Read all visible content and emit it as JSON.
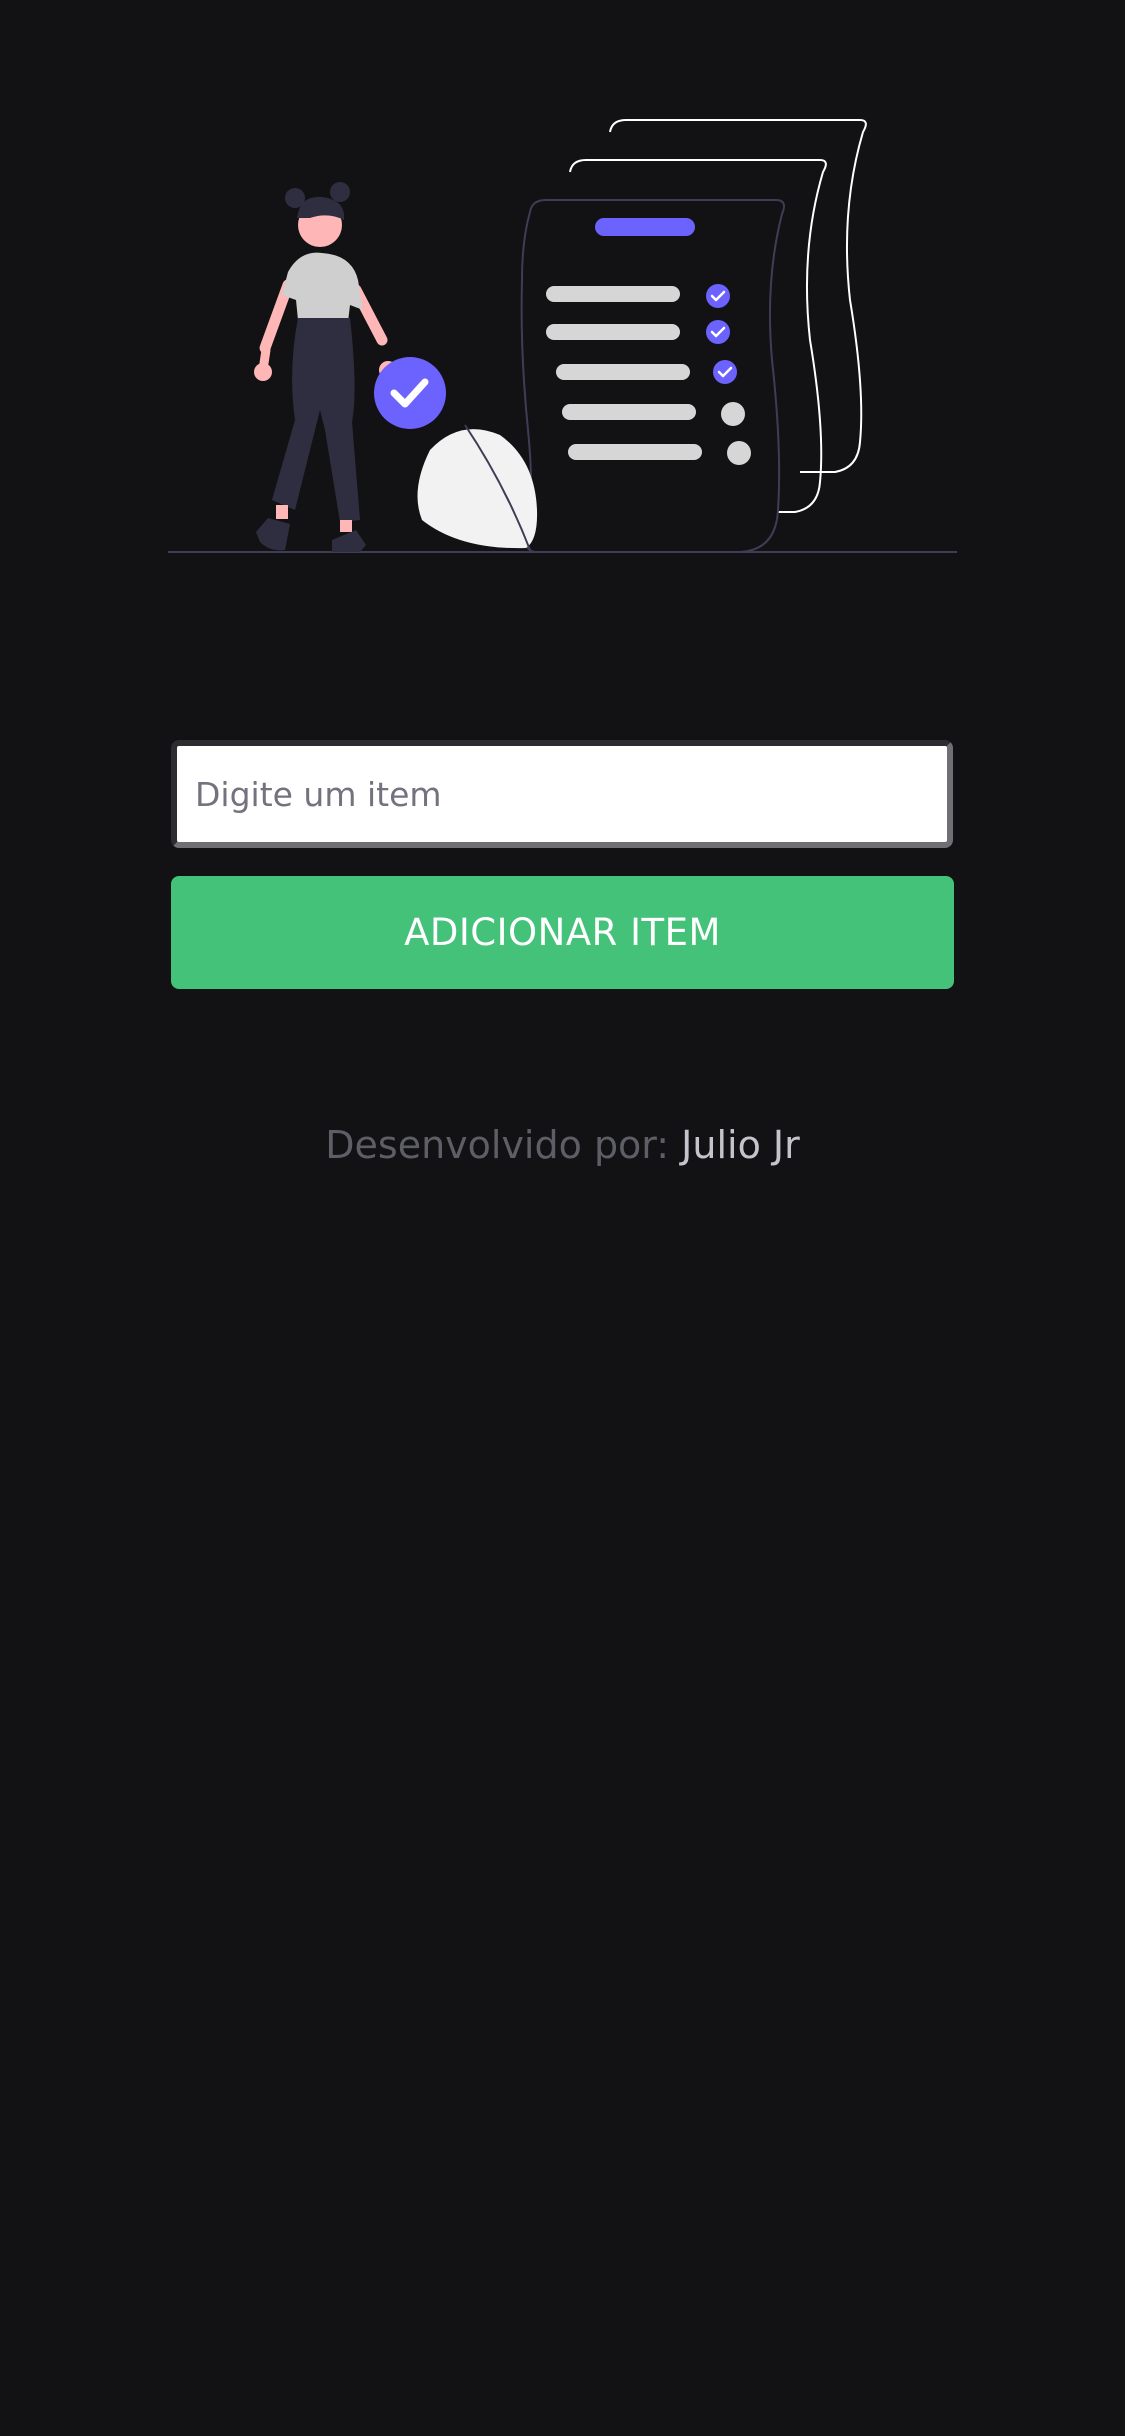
{
  "illustration": {
    "name": "todo-list-illustration",
    "colors": {
      "accent": "#6c63ff",
      "skin": "#ffb6b6",
      "dark": "#2f2e41",
      "line_grey": "#d6d6d6",
      "paper_outline": "#ffffff"
    }
  },
  "form": {
    "input_value": "",
    "input_placeholder": "Digite um item",
    "add_button_label": "ADICIONAR ITEM"
  },
  "footer": {
    "prefix": "Desenvolvido por:",
    "author": "Julio Jr"
  },
  "theme": {
    "background": "#121214",
    "button": "#44c27a",
    "footer_muted": "#5e5e66",
    "footer_author": "#c4c4cc"
  }
}
